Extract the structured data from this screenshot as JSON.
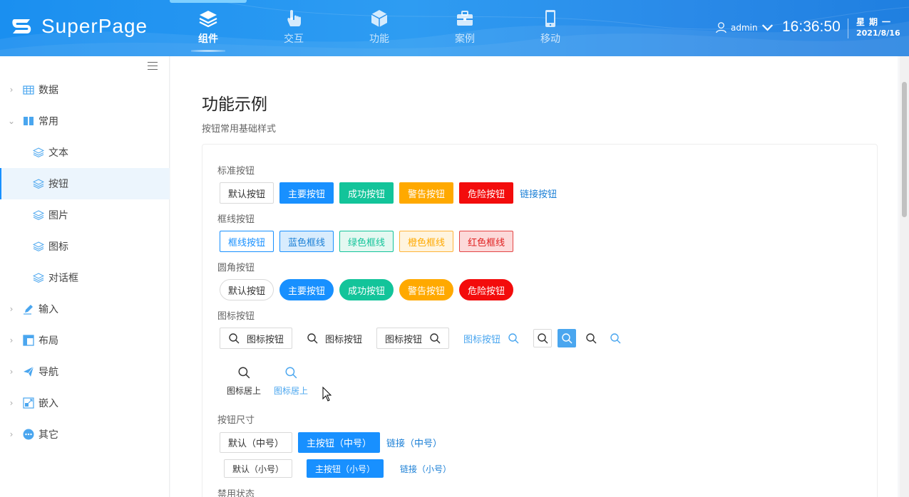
{
  "header": {
    "logo_text": "SuperPage",
    "nav": [
      {
        "label": "组件",
        "icon": "layers-icon",
        "active": true
      },
      {
        "label": "交互",
        "icon": "hand-pointer-icon",
        "active": false
      },
      {
        "label": "功能",
        "icon": "cube-icon",
        "active": false
      },
      {
        "label": "案例",
        "icon": "briefcase-icon",
        "active": false
      },
      {
        "label": "移动",
        "icon": "mobile-icon",
        "active": false
      }
    ],
    "user": "admin",
    "time": "16:36:50",
    "weekday": "星期一",
    "date": "2021/8/16"
  },
  "sidebar": {
    "items": [
      {
        "label": "数据",
        "icon": "table-icon",
        "expanded": false
      },
      {
        "label": "常用",
        "icon": "columns-icon",
        "expanded": true
      },
      {
        "label": "文本",
        "icon": "layers-icon",
        "child": true
      },
      {
        "label": "按钮",
        "icon": "layers-icon",
        "child": true,
        "active": true
      },
      {
        "label": "图片",
        "icon": "layers-icon",
        "child": true
      },
      {
        "label": "图标",
        "icon": "layers-icon",
        "child": true
      },
      {
        "label": "对话框",
        "icon": "layers-icon",
        "child": true
      },
      {
        "label": "输入",
        "icon": "pen-icon",
        "expanded": false
      },
      {
        "label": "布局",
        "icon": "grid-icon",
        "expanded": false
      },
      {
        "label": "导航",
        "icon": "paper-plane-icon",
        "expanded": false
      },
      {
        "label": "嵌入",
        "icon": "embed-icon",
        "expanded": false
      },
      {
        "label": "其它",
        "icon": "more-icon",
        "expanded": false
      }
    ]
  },
  "main": {
    "title": "功能示例",
    "subtitle": "按钮常用基础样式",
    "sections": {
      "standard": {
        "label": "标准按钮",
        "buttons": [
          "默认按钮",
          "主要按钮",
          "成功按钮",
          "警告按钮",
          "危险按钮",
          "链接按钮"
        ]
      },
      "outline": {
        "label": "框线按钮",
        "buttons": [
          "框线按钮",
          "蓝色框线",
          "绿色框线",
          "橙色框线",
          "红色框线"
        ]
      },
      "round": {
        "label": "圆角按钮",
        "buttons": [
          "默认按钮",
          "主要按钮",
          "成功按钮",
          "警告按钮",
          "危险按钮"
        ]
      },
      "icon": {
        "label": "图标按钮",
        "icon_btn_label": "图标按钮",
        "top_label": "图标居上"
      },
      "size": {
        "label": "按钮尺寸",
        "medium": [
          "默认（中号）",
          "主按钮（中号）",
          "链接（中号）"
        ],
        "small": [
          "默认（小号）",
          "主按钮（小号）",
          "链接（小号）"
        ]
      },
      "disabled": {
        "label": "禁用状态"
      }
    }
  },
  "colors": {
    "primary": "#1890ff",
    "success": "#13c49a",
    "warning": "#ffa900",
    "danger": "#f30c0c",
    "header": "#2e9cf2"
  }
}
